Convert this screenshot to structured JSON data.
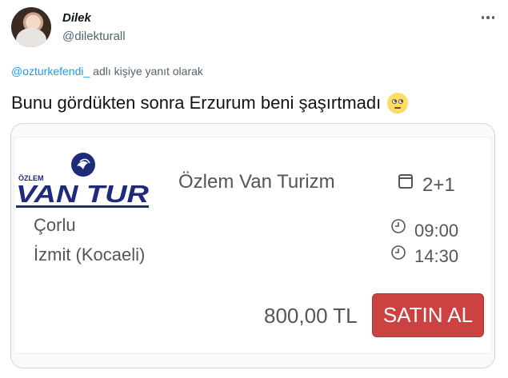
{
  "tweet": {
    "author_name": "Dilek",
    "author_handle": "@dilekturall",
    "reply_to_handle": "@ozturkefendi_",
    "reply_suffix": " adlı kişiye yanıt olarak",
    "text": "Bunu gördükten sonra Erzurum beni şaşırtmadı",
    "emoji": "face-with-rolling-eyes"
  },
  "ticket": {
    "logo_top_text": "ÖZLEM",
    "logo_main_text": "VAN TUR",
    "operator": "Özlem Van Turizm",
    "seat_layout": "2+1",
    "origin": "Çorlu",
    "destination": "İzmit (Kocaeli)",
    "departure_time": "09:00",
    "arrival_time": "14:30",
    "price": "800,00 TL",
    "buy_label": "SATIN AL",
    "colors": {
      "brand_navy": "#1e2a7a",
      "buy_button": "#cc4240",
      "text_gray": "#555555"
    }
  },
  "colors": {
    "link": "#1d9bf0",
    "secondary": "#536471"
  }
}
